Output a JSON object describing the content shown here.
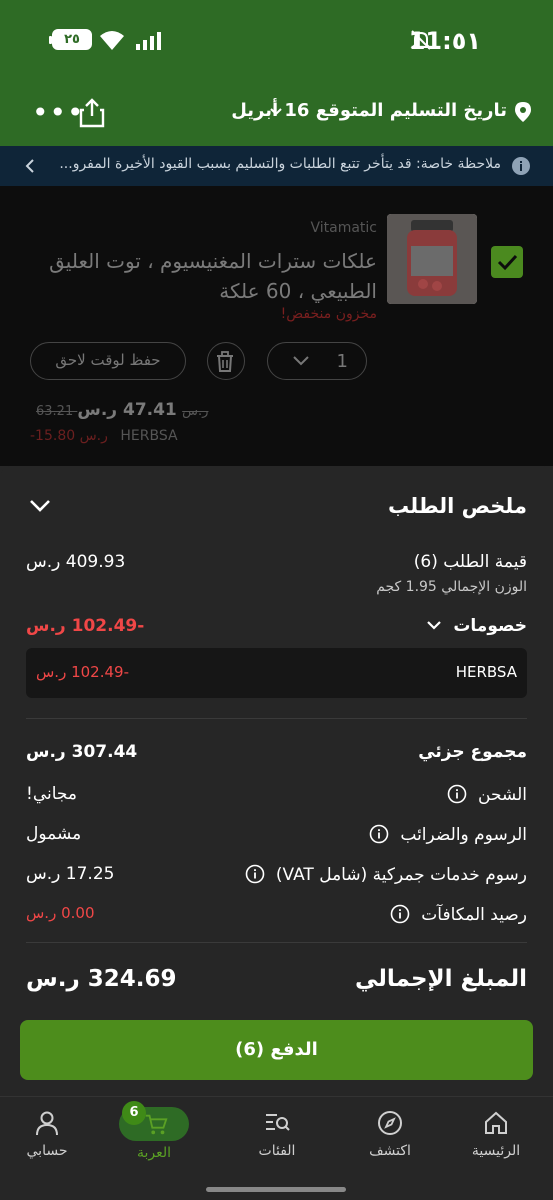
{
  "status_bar": {
    "time": "11:٥١",
    "battery": "٢٥"
  },
  "header": {
    "delivery_label": "تاريخ التسليم المتوقع 16 أبريل",
    "icons": [
      "location-pin-icon",
      "chevron-down-icon",
      "share-icon",
      "more-icon"
    ]
  },
  "notice": {
    "text": "ملاحظة خاصة: قد يتأخر تتبع الطلبات والتسليم بسبب القيود الأخيرة المفرو..."
  },
  "cart_item": {
    "brand": "Vitamatic",
    "name": "علكات سترات المغنيسيوم ، توت العليق الطبيعي ، 60 علكة",
    "stock_warning": "مخزون منخفض!",
    "quantity": "1",
    "save_for_later": "حفظ لوقت لاحق",
    "price": "47.41 ر.س",
    "old_price": "63.21 ر.س",
    "discount": "-15.80 ر.س",
    "discount_code": "HERBSA",
    "checked": true
  },
  "summary": {
    "title": "ملخص الطلب",
    "order_value_label": "قيمة الطلب (6)",
    "order_value": "409.93 ر.س",
    "weight_label": "الوزن الإجمالي 1.95 كجم",
    "discounts_label": "خصومات",
    "discounts_value": "-102.49 ر.س",
    "discount_code": "HERBSA",
    "discount_code_value": "-102.49 ر.س",
    "subtotal_label": "مجموع جزئي",
    "subtotal_value": "307.44 ر.س",
    "shipping_label": "الشحن",
    "shipping_value": "مجاني!",
    "fees_label": "الرسوم والضرائب",
    "fees_value": "مشمول",
    "customs_label": "رسوم خدمات جمركية (شامل VAT)",
    "customs_value": "17.25 ر.س",
    "rewards_label": "رصيد المكافآت",
    "rewards_value": "0.00 ر.س",
    "total_label": "المبلغ الإجمالي",
    "total_value": "324.69 ر.س",
    "pay_button": "الدفع (6)"
  },
  "nav": {
    "items": [
      {
        "label": "الرئيسية",
        "icon": "home-icon"
      },
      {
        "label": "اكتشف",
        "icon": "compass-icon"
      },
      {
        "label": "الفئات",
        "icon": "categories-search-icon"
      },
      {
        "label": "العربة",
        "icon": "cart-icon",
        "badge": "6",
        "active": true
      },
      {
        "label": "حسابي",
        "icon": "user-icon"
      }
    ]
  },
  "colors": {
    "brand_green": "#2e6b25",
    "button_green": "#4d8d1c",
    "discount_red": "#f04747",
    "sheet_bg": "#262626"
  }
}
